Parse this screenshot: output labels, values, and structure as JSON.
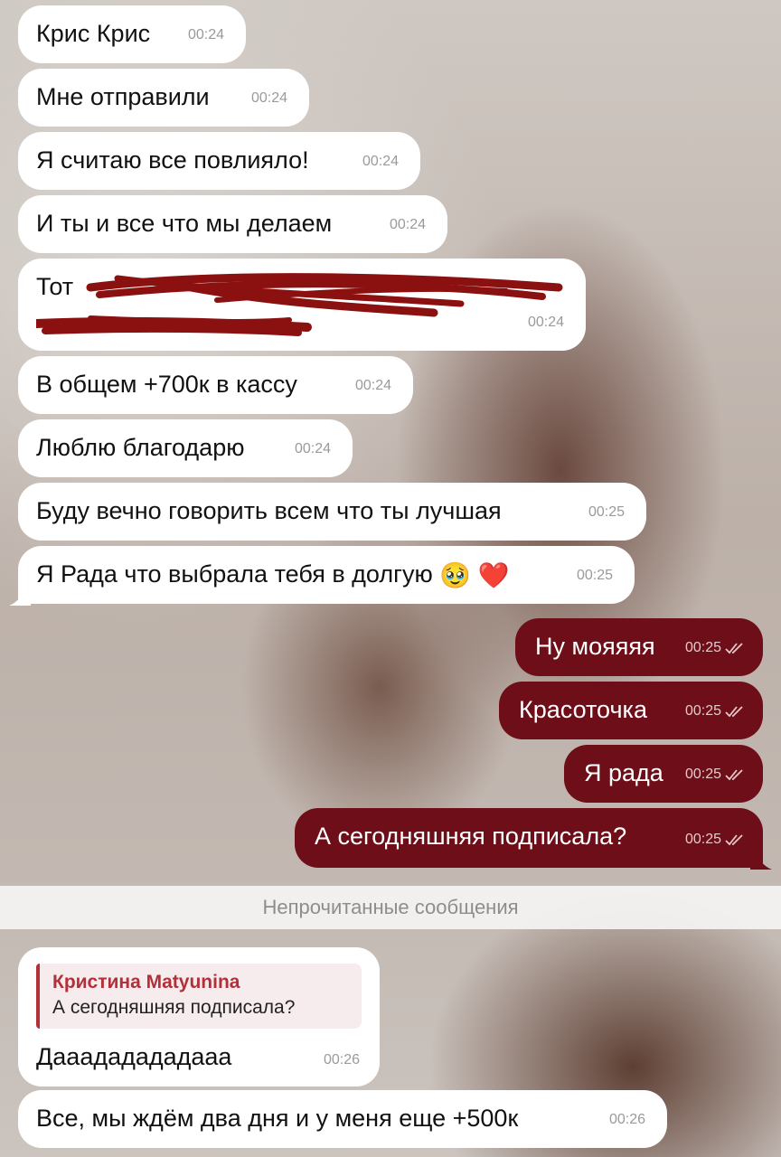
{
  "messages_in": [
    {
      "text": "Крис Крис",
      "time": "00:24"
    },
    {
      "text": "Мне отправили",
      "time": "00:24"
    },
    {
      "text": "Я считаю все повлияло!",
      "time": "00:24"
    },
    {
      "text": "И ты и все что мы делаем",
      "time": "00:24"
    },
    {
      "text_line1": "Тот",
      "text_line2": "",
      "time": "00:24"
    },
    {
      "text": "В общем +700к в кассу",
      "time": "00:24"
    },
    {
      "text": "Люблю благодарю",
      "time": "00:24"
    },
    {
      "text": "Буду вечно говорить всем что ты лучшая",
      "time": "00:25"
    },
    {
      "text": "Я Рада что выбрала тебя в долгую",
      "emoji1": "🥹",
      "emoji2": "❤️",
      "time": "00:25"
    }
  ],
  "messages_out": [
    {
      "text": "Ну мояяяя",
      "time": "00:25"
    },
    {
      "text": "Красоточка",
      "time": "00:25"
    },
    {
      "text": "Я рада",
      "time": "00:25"
    },
    {
      "text": "А сегодняшняя подписала?",
      "time": "00:25"
    }
  ],
  "unread_label": "Непрочитанные сообщения",
  "reply_message": {
    "quote_author": "Кристина Matyunina",
    "quote_text": "А сегодняшняя подписала?",
    "text": "Дааададададааа",
    "time": "00:26"
  },
  "last_message": {
    "text": "Все, мы ждём два дня и у меня еще +500к",
    "time": "00:26"
  },
  "colors": {
    "outgoing_bubble": "#6e0e18",
    "incoming_bubble": "#ffffff",
    "accent": "#b1303a",
    "redaction": "#8b1010"
  },
  "icons": {
    "read_receipt": "double-check-icon"
  }
}
